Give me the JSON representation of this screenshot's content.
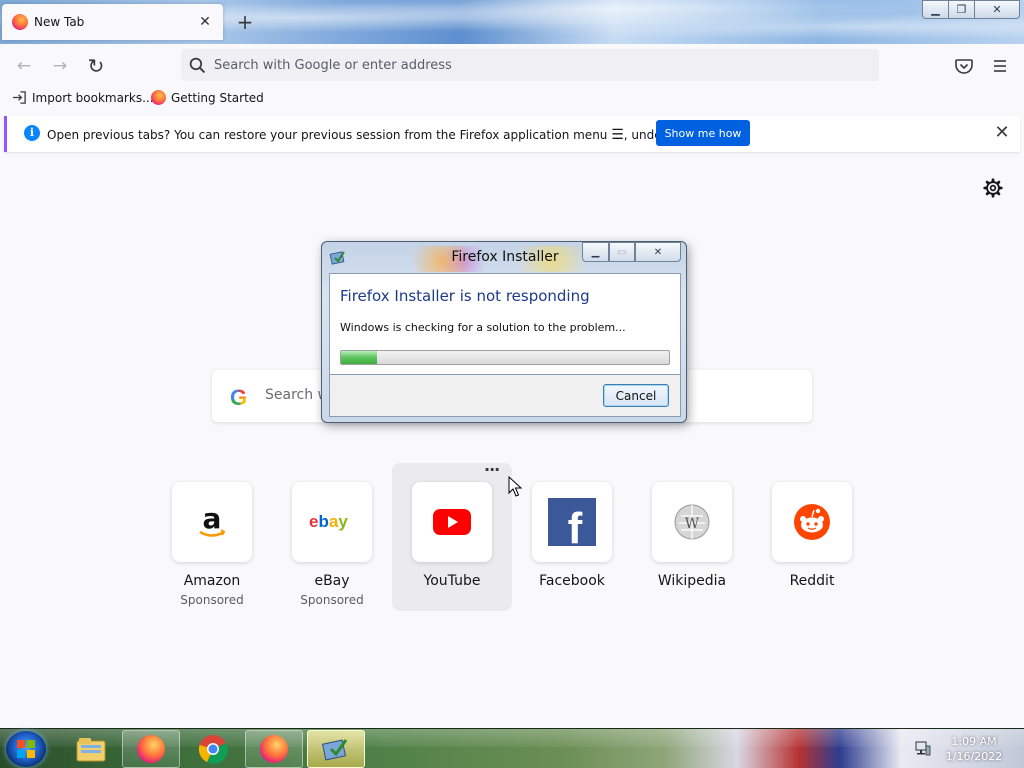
{
  "browser": {
    "tab": {
      "title": "New Tab",
      "close": "✕"
    },
    "new_tab": "+",
    "window_controls": {
      "minimize": "▁",
      "maximize": "❐",
      "close": "✕"
    },
    "nav": {
      "back": "←",
      "forward": "→",
      "reload": "↻"
    },
    "urlbar": {
      "placeholder": "Search with Google or enter address",
      "value": ""
    },
    "bookmarks": [
      {
        "label": "Import bookmarks...",
        "icon": "import-icon"
      },
      {
        "label": "Getting Started",
        "icon": "firefox-icon"
      }
    ]
  },
  "notification": {
    "icon": "i",
    "bold": "Open previous tabs?",
    "text": " You can restore your previous session from the Firefox application menu ",
    "menu_glyph": "☰",
    "text_end": ", under History.",
    "button": "Show me how",
    "close": "✕"
  },
  "newtab": {
    "search_placeholder": "Search w",
    "google_letter": "G",
    "tiles": [
      {
        "name": "Amazon",
        "sponsored": "Sponsored",
        "icon": "amazon-icon"
      },
      {
        "name": "eBay",
        "sponsored": "Sponsored",
        "icon": "ebay-icon"
      },
      {
        "name": "YouTube",
        "sponsored": "",
        "icon": "youtube-icon",
        "hover": true,
        "menu": "···"
      },
      {
        "name": "Facebook",
        "sponsored": "",
        "icon": "facebook-icon"
      },
      {
        "name": "Wikipedia",
        "sponsored": "",
        "icon": "wikipedia-icon"
      },
      {
        "name": "Reddit",
        "sponsored": "",
        "icon": "reddit-icon"
      }
    ]
  },
  "dialog": {
    "title": "Firefox Installer",
    "controls": {
      "minimize": "▁",
      "maximize": "▭",
      "close": "✕"
    },
    "heading": "Firefox Installer is not responding",
    "message": "Windows is checking for a solution to the problem...",
    "progress": 0.11,
    "cancel": "Cancel"
  },
  "taskbar": {
    "items": [
      "explorer-icon",
      "firefox-icon",
      "chrome-icon",
      "firefox-icon",
      "installer-icon"
    ],
    "time": "1:09 AM",
    "date": "1/16/2022"
  },
  "colors": {
    "accent": "#0061e0",
    "notice_border": "#9059ff",
    "dialog_heading": "#1e3a8a",
    "youtube": "#ff0000",
    "facebook": "#3b5998",
    "reddit": "#ff4500"
  }
}
